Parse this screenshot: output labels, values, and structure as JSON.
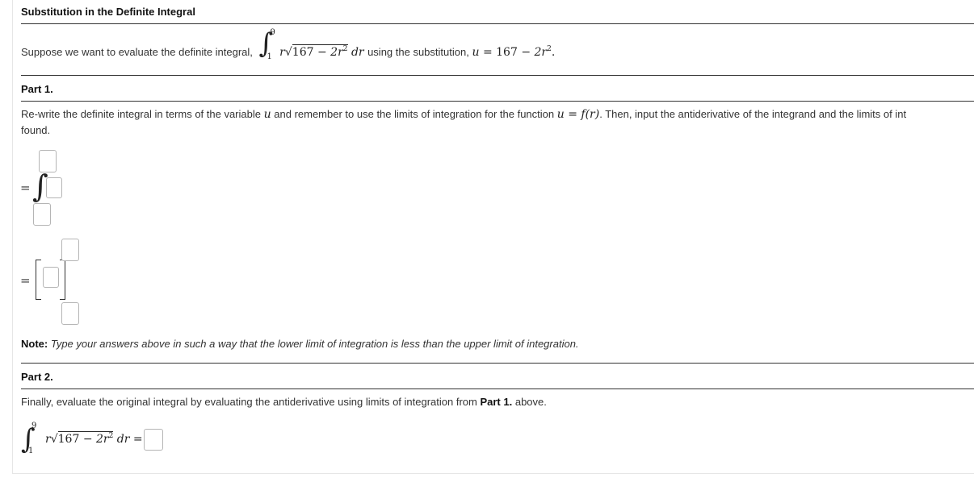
{
  "title": "Substitution in the Definite Integral",
  "intro": {
    "prefix": "Suppose we want to evaluate the definite integral,",
    "integral": {
      "lower": "1",
      "upper": "9",
      "var": "r",
      "radicand_const": "167",
      "minus": "−",
      "radicand_term": "2r",
      "exp": "2",
      "dvar": "dr"
    },
    "middle": "using the substitution,",
    "substitution": {
      "lhs": "u",
      "eq": "=",
      "const": "167",
      "minus": "−",
      "term": "2r",
      "exp": "2",
      "end": "."
    }
  },
  "part1": {
    "heading": "Part 1.",
    "instructions_a": "Re-write the definite integral in terms of the variable",
    "var_u": "u",
    "instructions_b": "and remember to use the limits of integration for the function",
    "func": "u = f(r)",
    "instructions_c": ". Then, input the antiderivative of the integrand and the limits of int",
    "instructions_line2": "found.",
    "equals": "=",
    "integral_sign": "∫",
    "note_label": "Note:",
    "note_text": "Type your answers above in such a way that the lower limit of integration is less than the upper limit of integration."
  },
  "part2": {
    "heading": "Part 2.",
    "instructions_a": "Finally, evaluate the original integral by evaluating the antiderivative using limits of integration from",
    "instructions_bold": "Part 1.",
    "instructions_b": "above.",
    "integral_sign": "∫",
    "equals": "="
  }
}
